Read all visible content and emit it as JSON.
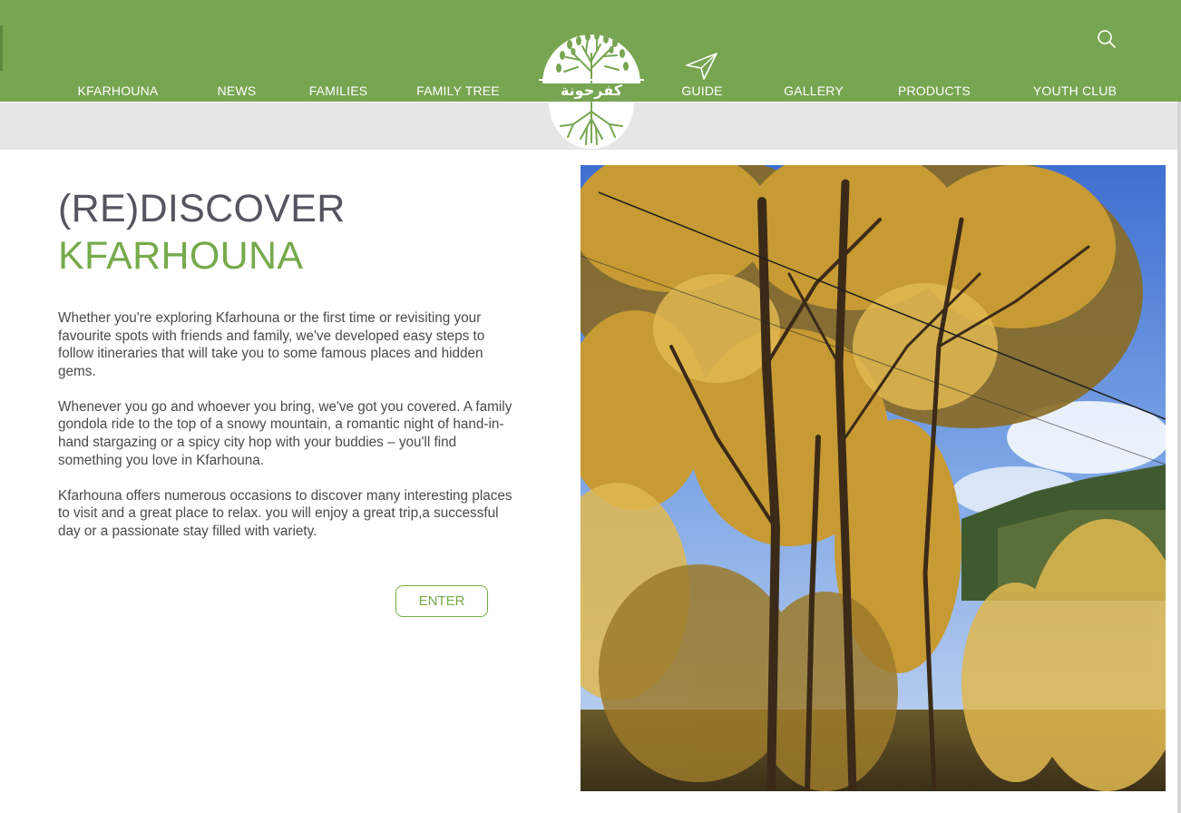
{
  "header": {
    "nav_left": [
      "KFARHOUNA",
      "NEWS",
      "FAMILIES",
      "FAMILY TREE"
    ],
    "nav_right": [
      "GUIDE",
      "GALLERY",
      "PRODUCTS",
      "YOUTH CLUB"
    ],
    "logo_text": "كفرحونة",
    "icons": {
      "guide": "navigation-arrow-icon",
      "search": "search-icon"
    }
  },
  "main": {
    "title_line1": "(RE)DISCOVER",
    "title_line2": "KFARHOUNA",
    "paragraphs": [
      "Whether you're exploring Kfarhouna or the first time or revisiting your favourite spots with friends and family, we've developed easy steps to follow itineraries that will take you to some famous places and hidden gems.",
      "Whenever you go and whoever you bring, we've got you covered. A family gondola ride to the top of a snowy mountain, a romantic night of hand-in-hand stargazing or a spicy city hop with your buddies – you'll find something you love in Kfarhouna.",
      "Kfarhouna offers numerous occasions to discover many interesting places to visit and a great place to relax. you will enjoy a great trip,a successful day or a passionate stay filled with variety."
    ],
    "enter_label": "ENTER"
  },
  "colors": {
    "brand_green": "#77a551",
    "accent_green": "#76aa4b",
    "subbar_gray": "#e6e6e6",
    "title_gray": "#55555f"
  }
}
